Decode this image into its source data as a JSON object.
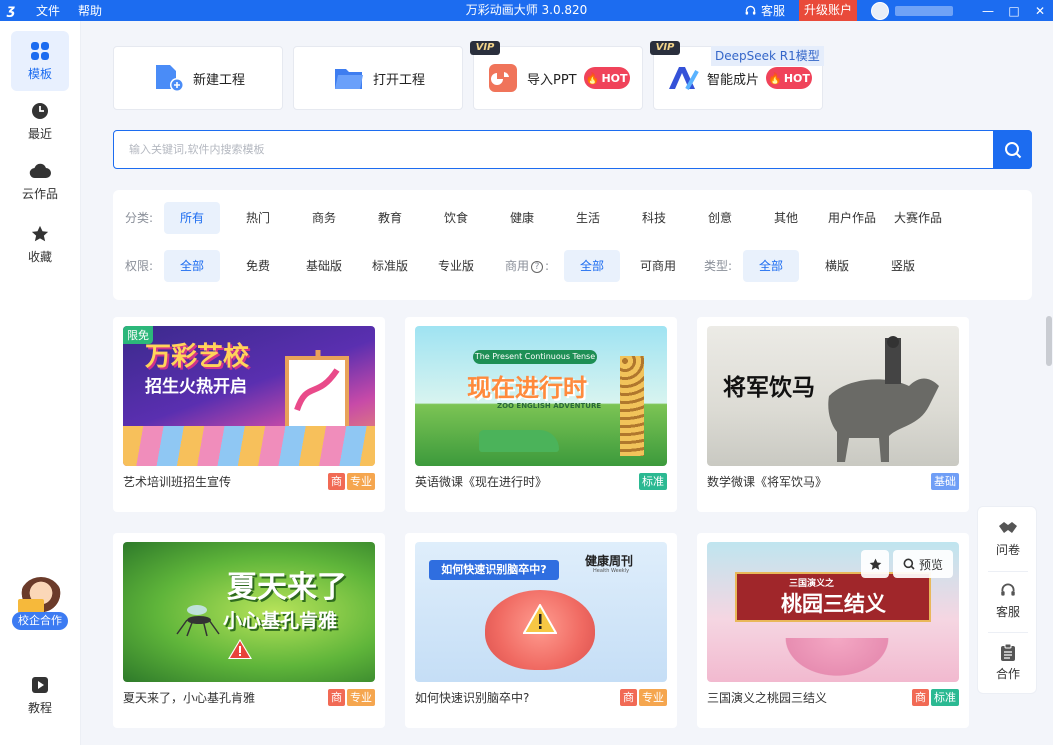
{
  "titlebar": {
    "menu_file": "文件",
    "menu_help": "帮助",
    "title": "万彩动画大师 3.0.820",
    "service": "客服",
    "upgrade": "升级账户",
    "min": "—",
    "max": "□",
    "close": "✕"
  },
  "sidebar": {
    "templates": "模板",
    "recent": "最近",
    "cloud": "云作品",
    "favorites": "收藏",
    "cooperation": "校企合作",
    "tutorial": "教程"
  },
  "quick": {
    "new_project": "新建工程",
    "open_project": "打开工程",
    "import_ppt": "导入PPT",
    "ai_video": "智能成片",
    "vip": "VIP",
    "hot": "HOT",
    "deepseek": "DeepSeek R1模型"
  },
  "search": {
    "placeholder": "输入关键词,软件内搜索模板"
  },
  "filters": {
    "category_label": "分类:",
    "categories": [
      "所有",
      "热门",
      "商务",
      "教育",
      "饮食",
      "健康",
      "生活",
      "科技",
      "创意",
      "其他",
      "用户作品",
      "大赛作品"
    ],
    "permission_label": "权限:",
    "permissions": [
      "全部",
      "免费",
      "基础版",
      "标准版",
      "专业版"
    ],
    "commercial_label": "商用",
    "commercial_suffix": ":",
    "commercial_options": [
      "全部",
      "可商用"
    ],
    "type_label": "类型:",
    "types": [
      "全部",
      "横版",
      "竖版"
    ]
  },
  "cards": [
    {
      "name": "艺术培训班招生宣传",
      "badges": [
        "商",
        "专业"
      ],
      "free": "限免",
      "title": "万彩艺校",
      "subtitle": "招生火热开启"
    },
    {
      "name": "英语微课《现在进行时》",
      "badges": [
        "标准"
      ],
      "title": "现在进行时",
      "banner": "The Present Continuous Tense",
      "subtitle": "ZOO ENGLISH ADVENTURE"
    },
    {
      "name": "数学微课《将军饮马》",
      "badges": [
        "基础"
      ],
      "title": "将军饮马"
    },
    {
      "name": "夏天来了，小心基孔肯雅",
      "badges": [
        "商",
        "专业"
      ],
      "title": "夏天来了",
      "subtitle": "小心基孔肯雅"
    },
    {
      "name": "如何快速识别脑卒中?",
      "badges": [
        "商",
        "专业"
      ],
      "title": "如何快速识别脑卒中?",
      "tag": "健康周刊",
      "tag_en": "Health Weekly"
    },
    {
      "name": "三国演义之桃园三结义",
      "badges": [
        "商",
        "标准"
      ],
      "title": "桃园三结义",
      "subtitle": "三国演义之",
      "preview": "预览"
    }
  ],
  "right_panel": {
    "survey": "问卷",
    "service": "客服",
    "cooperate": "合作"
  }
}
